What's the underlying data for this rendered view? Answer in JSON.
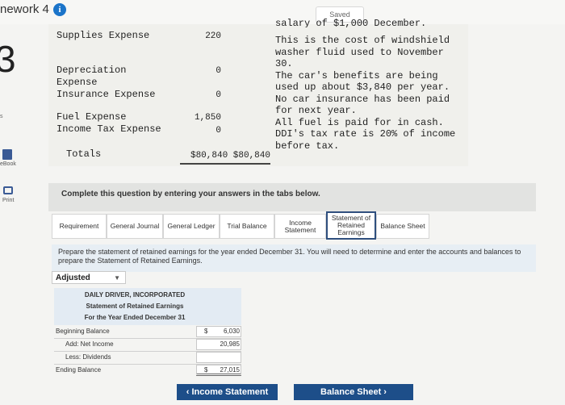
{
  "header": {
    "title_fragment": "nework 4",
    "info_icon": "i",
    "saved_label": "Saved"
  },
  "question_number": "3",
  "sidebar": {
    "fragment_s": "s",
    "ebook_label": "eBook",
    "print_label": "Print"
  },
  "ledger": {
    "rows": [
      {
        "label": "Supplies Expense",
        "debit": "220"
      },
      {
        "label": "Depreciation\nExpense",
        "debit": "0"
      },
      {
        "label": "Insurance Expense",
        "debit": "0"
      },
      {
        "label": "Fuel Expense",
        "debit": "1,850"
      },
      {
        "label": "Income Tax Expense",
        "debit": "0"
      }
    ],
    "totals_label": "Totals",
    "totals_values": "$80,840 $80,840"
  },
  "notes": {
    "cut_line": "salary of $1,000 December.",
    "text": "This is the cost of windshield\nwasher fluid used to November\n30.\nThe car's benefits are being\nused up about $3,840 per year.\nNo car insurance has been paid\nfor next year.\nAll fuel is paid for in cash.\nDDI's tax rate is 20% of income\nbefore tax."
  },
  "instruction": "Complete this question by entering your answers in the tabs below.",
  "tabs": [
    "Requirement",
    "General Journal",
    "General Ledger",
    "Trial Balance",
    "Income Statement",
    "Statement of Retained Earnings",
    "Balance Sheet"
  ],
  "description": "Prepare the statement of retained earnings for the year ended December 31. You will need to determine and enter the accounts and balances to prepare the Statement of Retained Earnings.",
  "adjusted_select": "Adjusted",
  "statement": {
    "company": "DAILY DRIVER, INCORPORATED",
    "name": "Statement of Retained Earnings",
    "period": "For the Year Ended December 31",
    "rows": [
      {
        "label": "Beginning Balance",
        "dollar": "$",
        "value": "6,030"
      },
      {
        "label": "Add: Net Income",
        "dollar": "",
        "value": "20,985"
      },
      {
        "label": "Less: Dividends",
        "dollar": "",
        "value": ""
      },
      {
        "label": "Ending Balance",
        "dollar": "$",
        "value": "27,015"
      }
    ]
  },
  "nav": {
    "prev": "‹  Income Statement",
    "next": "Balance Sheet  ›"
  }
}
